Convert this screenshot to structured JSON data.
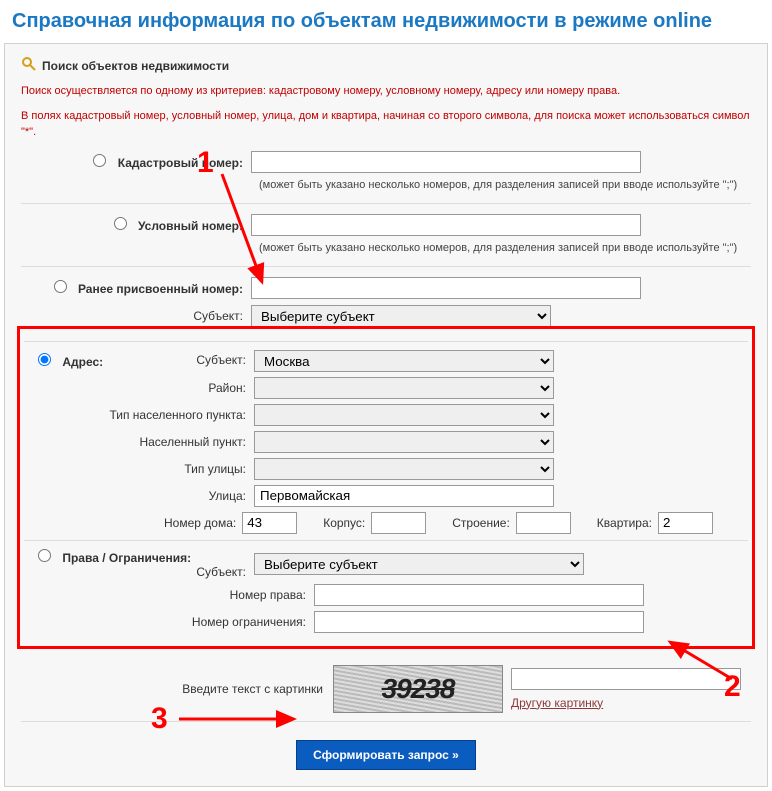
{
  "title": "Справочная информация по объектам недвижимости в режиме online",
  "fieldset": "Поиск объектов недвижимости",
  "hint1": "Поиск осуществляется по одному из критериев: кадастровому номеру, условному номеру, адресу или номеру права.",
  "hint2": "В полях кадастровый номер, условный номер, улица, дом и квартира, начиная со второго символа, для поиска может использоваться символ \"*\".",
  "cad": {
    "label": "Кадастровый номер:",
    "value": "",
    "note": "(может быть указано несколько номеров, для разделения записей при вводе используйте \";\")"
  },
  "cond": {
    "label": "Условный номер:",
    "value": "",
    "note": "(может быть указано несколько номеров, для разделения записей при вводе используйте \";\")"
  },
  "prev": {
    "label": "Ранее присвоенный номер:",
    "value": "",
    "subj_label": "Субъект:",
    "subj_sel": "Выберите субъект"
  },
  "addr": {
    "label": "Адрес:",
    "subj_l": "Субъект:",
    "subj_v": "Москва",
    "raion_l": "Район:",
    "raion_v": "",
    "type_np_l": "Тип населенного пункта:",
    "type_np_v": "",
    "np_l": "Населенный пункт:",
    "np_v": "",
    "type_st_l": "Тип улицы:",
    "type_st_v": "",
    "street_l": "Улица:",
    "street_v": "Первомайская",
    "house_l": "Номер дома:",
    "house_v": "43",
    "korpus_l": "Корпус:",
    "korpus_v": "",
    "str_l": "Строение:",
    "str_v": "",
    "kv_l": "Квартира:",
    "kv_v": "2"
  },
  "rights": {
    "label": "Права / Ограничения:",
    "subj_l": "Субъект:",
    "subj_v": "Выберите субъект",
    "num_l": "Номер права:",
    "num_v": "",
    "lim_l": "Номер ограничения:",
    "lim_v": ""
  },
  "captcha": {
    "label": "Введите текст с картинки",
    "img_text": "39238",
    "link": "Другую картинку",
    "input": ""
  },
  "submit": "Сформировать запрос »",
  "anno": {
    "n1": "1",
    "n2": "2",
    "n3": "3"
  }
}
